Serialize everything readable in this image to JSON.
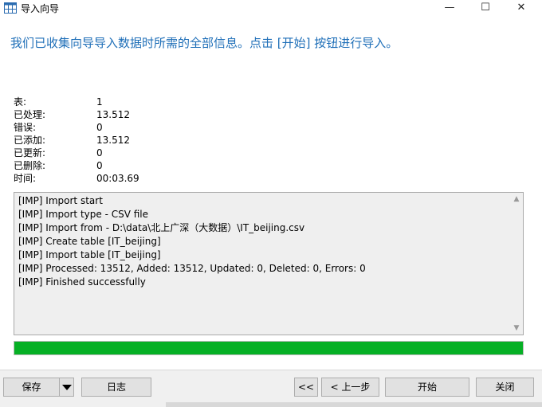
{
  "window": {
    "title": "导入向导",
    "minimize_glyph": "—",
    "maximize_glyph": "☐",
    "close_glyph": "✕"
  },
  "headline": "我们已收集向导导入数据时所需的全部信息。点击 [开始] 按钮进行导入。",
  "stats": [
    {
      "label": "表:",
      "value": "1"
    },
    {
      "label": "已处理:",
      "value": "13.512"
    },
    {
      "label": "错误:",
      "value": "0"
    },
    {
      "label": "已添加:",
      "value": "13.512"
    },
    {
      "label": "已更新:",
      "value": "0"
    },
    {
      "label": "已删除:",
      "value": "0"
    },
    {
      "label": "时间:",
      "value": "00:03.69"
    }
  ],
  "log": [
    "[IMP] Import start",
    "[IMP] Import type - CSV file",
    "[IMP] Import from - D:\\data\\北上广深（大数据）\\IT_beijing.csv",
    "[IMP] Create table [IT_beijing]",
    "[IMP] Import table [IT_beijing]",
    "[IMP] Processed: 13512, Added: 13512, Updated: 0, Deleted: 0, Errors: 0",
    "[IMP] Finished successfully"
  ],
  "progress": {
    "fraction": 1.0,
    "color": "#06b025"
  },
  "buttons": {
    "save": "保存",
    "log": "日志",
    "first": "<<",
    "back": "< 上一步",
    "start": "开始",
    "close": "关闭"
  },
  "colors": {
    "headline": "#1f6fb8",
    "log_background": "#efefef"
  },
  "icons": {
    "app": "table-grid-icon",
    "save_dropdown": "chevron-down-icon"
  }
}
